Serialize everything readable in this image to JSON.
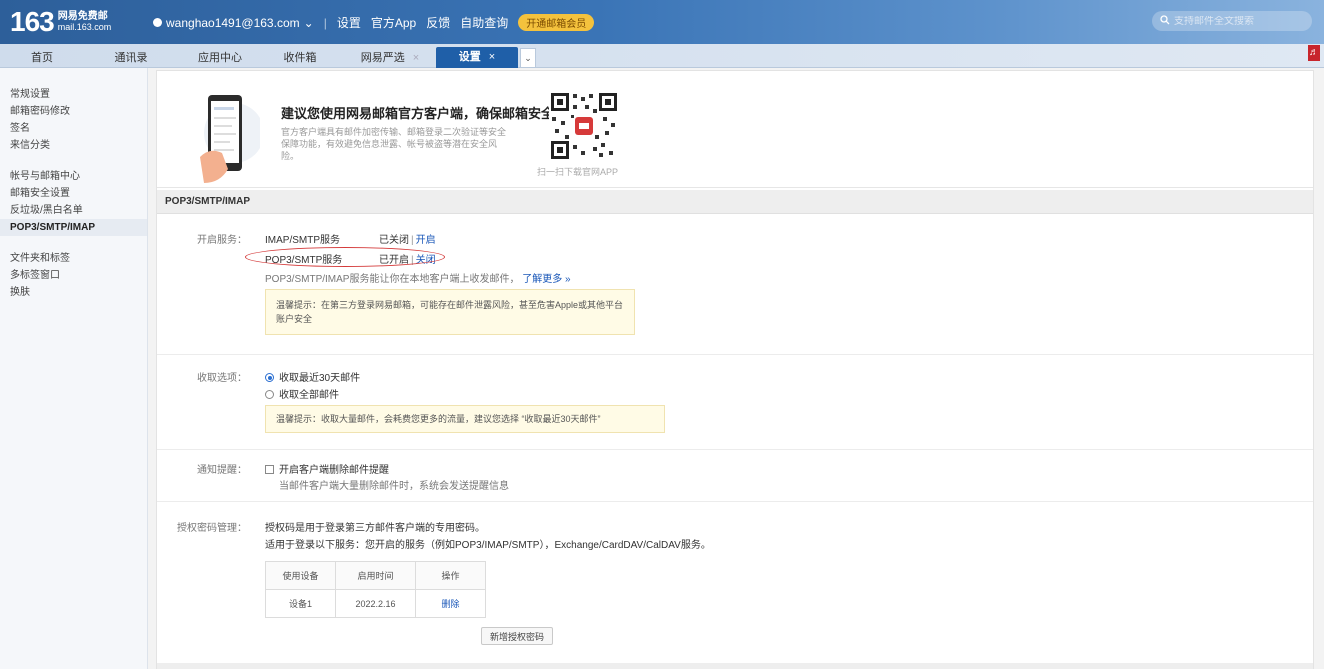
{
  "header": {
    "logo_number": "163",
    "logo_line1": "网易免费邮",
    "logo_line2": "mail.163.com",
    "account": "wanghao1491@163.com",
    "account_caret": "⌄",
    "links": [
      "设置",
      "官方App",
      "反馈",
      "自助查询"
    ],
    "vip_label": "开通邮箱会员",
    "search_placeholder": "支持邮件全文搜索"
  },
  "tabs": [
    {
      "label": "首页"
    },
    {
      "label": "通讯录"
    },
    {
      "label": "应用中心"
    },
    {
      "label": "收件箱"
    },
    {
      "label": "网易严选",
      "close": "×"
    },
    {
      "label": "设置",
      "close": "×"
    }
  ],
  "tab_more": "⌄",
  "corner_icon": "♬",
  "sidebar": {
    "group1": [
      "常规设置",
      "邮箱密码修改",
      "签名",
      "来信分类"
    ],
    "group2": [
      "帐号与邮箱中心",
      "邮箱安全设置",
      "反垃圾/黑白名单",
      "POP3/SMTP/IMAP"
    ],
    "group3": [
      "文件夹和标签",
      "多标签窗口",
      "换肤"
    ]
  },
  "promo": {
    "title": "建议您使用网易邮箱官方客户端，确保邮箱安全",
    "desc": "官方客户端具有邮件加密传输、邮箱登录二次验证等安全保障功能，有效避免信息泄露、帐号被盗等潜在安全风险。",
    "qr_caption": "扫一扫下载官网APP"
  },
  "section_title": "POP3/SMTP/IMAP",
  "service": {
    "label": "开启服务：",
    "rows": [
      {
        "name": "IMAP/SMTP服务",
        "status": "已关闭",
        "action": "开启"
      },
      {
        "name": "POP3/SMTP服务",
        "status": "已开启",
        "action": "关闭"
      }
    ],
    "note": "POP3/SMTP/IMAP服务能让你在本地客户端上收发邮件，",
    "learn_more": "了解更多 »",
    "tip": "温馨提示：在第三方登录网易邮箱，可能存在邮件泄露风险，甚至危害Apple或其他平台账户安全"
  },
  "receive": {
    "label": "收取选项：",
    "options": [
      "收取最近30天邮件",
      "收取全部邮件"
    ],
    "tip": "温馨提示：收取大量邮件，会耗费您更多的流量，建议您选择 “收取最近30天邮件”"
  },
  "notify": {
    "label": "通知提醒：",
    "checkbox_label": "开启客户端删除邮件提醒",
    "desc": "当邮件客户端大量删除邮件时，系统会发送提醒信息"
  },
  "auth": {
    "label": "授权密码管理：",
    "line1": "授权码是用于登录第三方邮件客户端的专用密码。",
    "line2": "适用于登录以下服务：您开启的服务（例如POP3/IMAP/SMTP），Exchange/CardDAV/CalDAV服务。",
    "table": {
      "headers": [
        "使用设备",
        "启用时间",
        "操作"
      ],
      "rows": [
        {
          "device": "设备1",
          "time": "2022.2.16",
          "action": "删除"
        }
      ]
    },
    "new_button": "新增授权密码"
  }
}
